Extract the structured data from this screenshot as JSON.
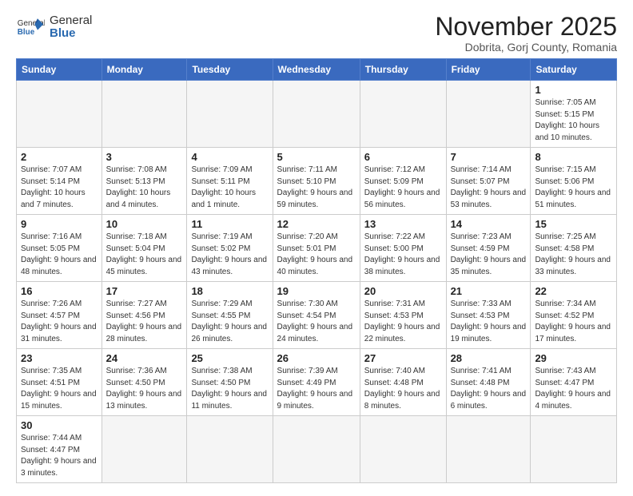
{
  "header": {
    "logo_general": "General",
    "logo_blue": "Blue",
    "month_title": "November 2025",
    "subtitle": "Dobrita, Gorj County, Romania"
  },
  "weekdays": [
    "Sunday",
    "Monday",
    "Tuesday",
    "Wednesday",
    "Thursday",
    "Friday",
    "Saturday"
  ],
  "weeks": [
    [
      {
        "day": "",
        "info": ""
      },
      {
        "day": "",
        "info": ""
      },
      {
        "day": "",
        "info": ""
      },
      {
        "day": "",
        "info": ""
      },
      {
        "day": "",
        "info": ""
      },
      {
        "day": "",
        "info": ""
      },
      {
        "day": "1",
        "info": "Sunrise: 7:05 AM\nSunset: 5:15 PM\nDaylight: 10 hours\nand 10 minutes."
      }
    ],
    [
      {
        "day": "2",
        "info": "Sunrise: 7:07 AM\nSunset: 5:14 PM\nDaylight: 10 hours\nand 7 minutes."
      },
      {
        "day": "3",
        "info": "Sunrise: 7:08 AM\nSunset: 5:13 PM\nDaylight: 10 hours\nand 4 minutes."
      },
      {
        "day": "4",
        "info": "Sunrise: 7:09 AM\nSunset: 5:11 PM\nDaylight: 10 hours\nand 1 minute."
      },
      {
        "day": "5",
        "info": "Sunrise: 7:11 AM\nSunset: 5:10 PM\nDaylight: 9 hours\nand 59 minutes."
      },
      {
        "day": "6",
        "info": "Sunrise: 7:12 AM\nSunset: 5:09 PM\nDaylight: 9 hours\nand 56 minutes."
      },
      {
        "day": "7",
        "info": "Sunrise: 7:14 AM\nSunset: 5:07 PM\nDaylight: 9 hours\nand 53 minutes."
      },
      {
        "day": "8",
        "info": "Sunrise: 7:15 AM\nSunset: 5:06 PM\nDaylight: 9 hours\nand 51 minutes."
      }
    ],
    [
      {
        "day": "9",
        "info": "Sunrise: 7:16 AM\nSunset: 5:05 PM\nDaylight: 9 hours\nand 48 minutes."
      },
      {
        "day": "10",
        "info": "Sunrise: 7:18 AM\nSunset: 5:04 PM\nDaylight: 9 hours\nand 45 minutes."
      },
      {
        "day": "11",
        "info": "Sunrise: 7:19 AM\nSunset: 5:02 PM\nDaylight: 9 hours\nand 43 minutes."
      },
      {
        "day": "12",
        "info": "Sunrise: 7:20 AM\nSunset: 5:01 PM\nDaylight: 9 hours\nand 40 minutes."
      },
      {
        "day": "13",
        "info": "Sunrise: 7:22 AM\nSunset: 5:00 PM\nDaylight: 9 hours\nand 38 minutes."
      },
      {
        "day": "14",
        "info": "Sunrise: 7:23 AM\nSunset: 4:59 PM\nDaylight: 9 hours\nand 35 minutes."
      },
      {
        "day": "15",
        "info": "Sunrise: 7:25 AM\nSunset: 4:58 PM\nDaylight: 9 hours\nand 33 minutes."
      }
    ],
    [
      {
        "day": "16",
        "info": "Sunrise: 7:26 AM\nSunset: 4:57 PM\nDaylight: 9 hours\nand 31 minutes."
      },
      {
        "day": "17",
        "info": "Sunrise: 7:27 AM\nSunset: 4:56 PM\nDaylight: 9 hours\nand 28 minutes."
      },
      {
        "day": "18",
        "info": "Sunrise: 7:29 AM\nSunset: 4:55 PM\nDaylight: 9 hours\nand 26 minutes."
      },
      {
        "day": "19",
        "info": "Sunrise: 7:30 AM\nSunset: 4:54 PM\nDaylight: 9 hours\nand 24 minutes."
      },
      {
        "day": "20",
        "info": "Sunrise: 7:31 AM\nSunset: 4:53 PM\nDaylight: 9 hours\nand 22 minutes."
      },
      {
        "day": "21",
        "info": "Sunrise: 7:33 AM\nSunset: 4:53 PM\nDaylight: 9 hours\nand 19 minutes."
      },
      {
        "day": "22",
        "info": "Sunrise: 7:34 AM\nSunset: 4:52 PM\nDaylight: 9 hours\nand 17 minutes."
      }
    ],
    [
      {
        "day": "23",
        "info": "Sunrise: 7:35 AM\nSunset: 4:51 PM\nDaylight: 9 hours\nand 15 minutes."
      },
      {
        "day": "24",
        "info": "Sunrise: 7:36 AM\nSunset: 4:50 PM\nDaylight: 9 hours\nand 13 minutes."
      },
      {
        "day": "25",
        "info": "Sunrise: 7:38 AM\nSunset: 4:50 PM\nDaylight: 9 hours\nand 11 minutes."
      },
      {
        "day": "26",
        "info": "Sunrise: 7:39 AM\nSunset: 4:49 PM\nDaylight: 9 hours\nand 9 minutes."
      },
      {
        "day": "27",
        "info": "Sunrise: 7:40 AM\nSunset: 4:48 PM\nDaylight: 9 hours\nand 8 minutes."
      },
      {
        "day": "28",
        "info": "Sunrise: 7:41 AM\nSunset: 4:48 PM\nDaylight: 9 hours\nand 6 minutes."
      },
      {
        "day": "29",
        "info": "Sunrise: 7:43 AM\nSunset: 4:47 PM\nDaylight: 9 hours\nand 4 minutes."
      }
    ],
    [
      {
        "day": "30",
        "info": "Sunrise: 7:44 AM\nSunset: 4:47 PM\nDaylight: 9 hours\nand 3 minutes."
      },
      {
        "day": "",
        "info": ""
      },
      {
        "day": "",
        "info": ""
      },
      {
        "day": "",
        "info": ""
      },
      {
        "day": "",
        "info": ""
      },
      {
        "day": "",
        "info": ""
      },
      {
        "day": "",
        "info": ""
      }
    ]
  ]
}
